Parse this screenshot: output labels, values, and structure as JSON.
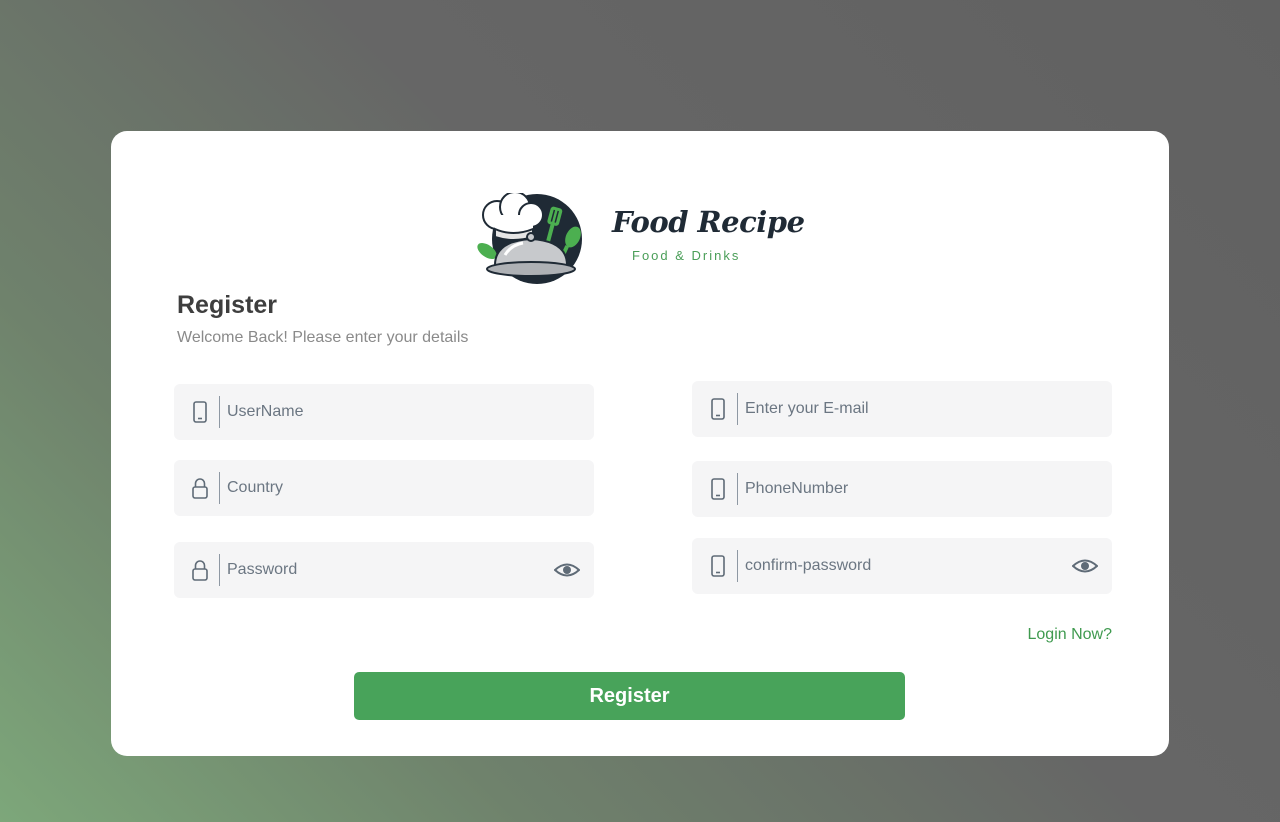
{
  "brand": {
    "title": "Food Recipe",
    "tagline": "Food & Drinks",
    "accent_color": "#48a35a"
  },
  "form": {
    "heading": "Register",
    "subheading": "Welcome Back! Please enter your details",
    "fields": {
      "username": {
        "placeholder": "UserName",
        "icon": "phone-icon"
      },
      "country": {
        "placeholder": "Country",
        "icon": "lock-icon"
      },
      "password": {
        "placeholder": "Password",
        "icon": "lock-icon",
        "toggle_icon": "eye-icon"
      },
      "email": {
        "placeholder": "Enter your E-mail",
        "icon": "phone-icon"
      },
      "phone": {
        "placeholder": "PhoneNumber",
        "icon": "phone-icon"
      },
      "confirm_password": {
        "placeholder": "confirm-password",
        "icon": "phone-icon",
        "toggle_icon": "eye-icon"
      }
    },
    "login_link": "Login Now?",
    "submit_label": "Register"
  }
}
